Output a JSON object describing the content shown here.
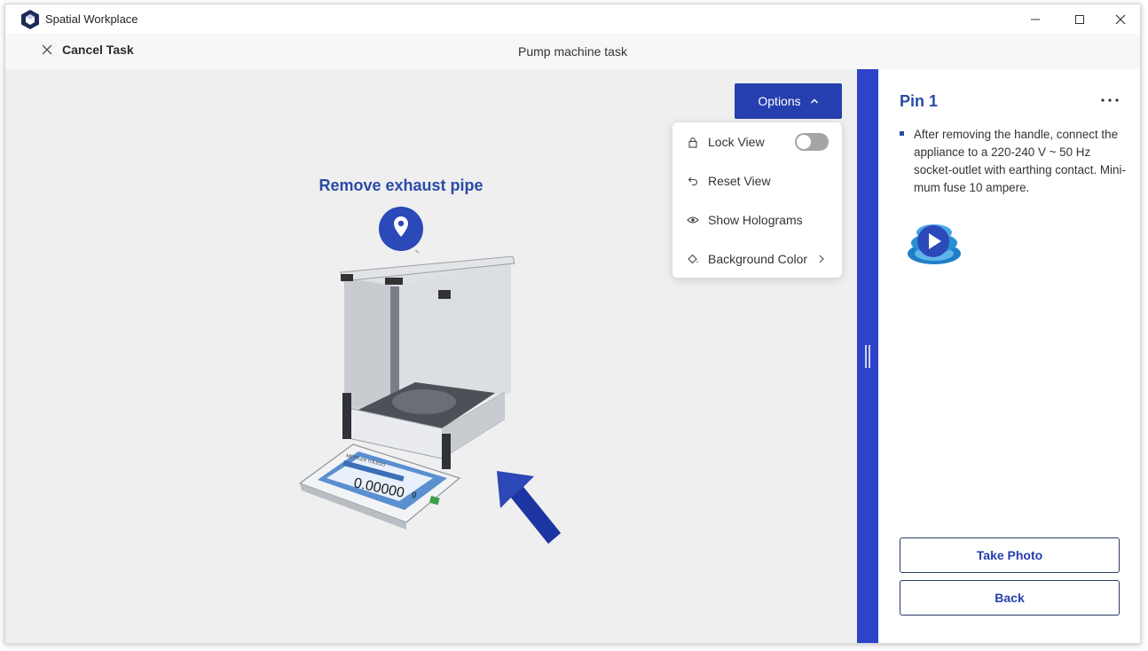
{
  "app": {
    "title": "Spatial Workplace"
  },
  "header": {
    "cancel_label": "Cancel Task",
    "task_title": "Pump machine task"
  },
  "viewport": {
    "options_label": "Options",
    "step_label": "Remove exhaust pipe",
    "menu": {
      "lock_view": "Lock View",
      "lock_view_enabled": false,
      "reset_view": "Reset View",
      "show_holograms": "Show Holograms",
      "background_color": "Background Color"
    },
    "device_readout": "0.00000",
    "device_unit": "g",
    "device_brand": "METTLER TOLEDO"
  },
  "panel": {
    "pin_title": "Pin 1",
    "instruction": "After removing the handle, connect the appliance to a 220-240 V ~ 50 Hz socket-outlet with earthing contact. Mini-mum fuse 10 ampere.",
    "take_photo_label": "Take Photo",
    "back_label": "Back"
  },
  "colors": {
    "accent": "#253fae",
    "divider": "#2e44c8",
    "viewport_bg": "#efefef"
  }
}
